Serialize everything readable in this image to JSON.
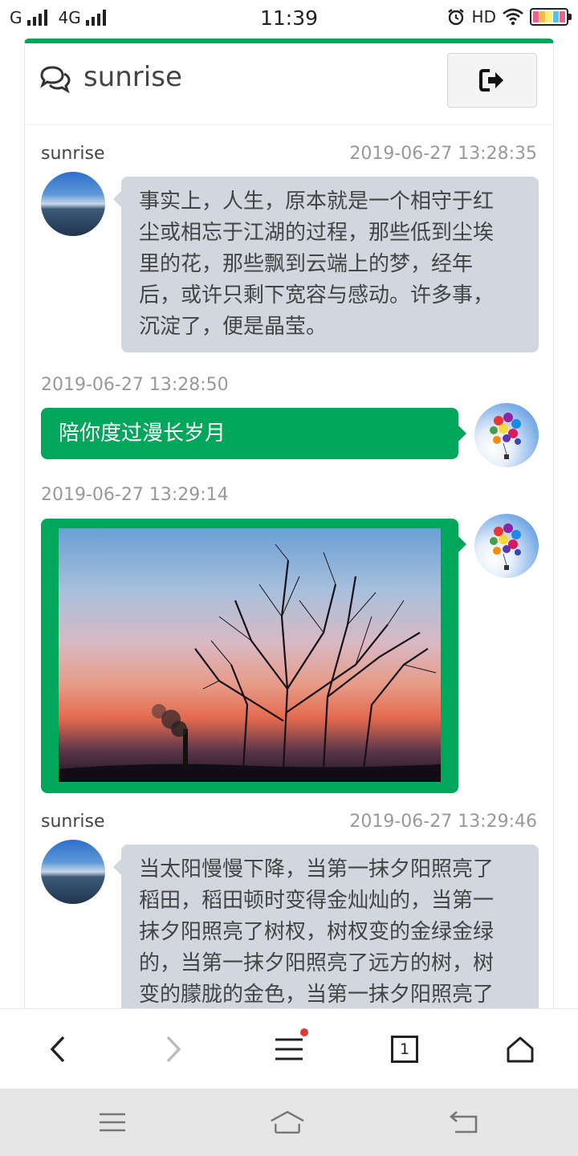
{
  "status_bar": {
    "carrier1": "G",
    "carrier2": "4G",
    "time": "11:39",
    "hd": "HD"
  },
  "header": {
    "title": "sunrise",
    "icon": "comments-icon",
    "logout_icon": "sign-out-icon"
  },
  "messages": [
    {
      "sender": "sunrise",
      "time": "2019-06-27 13:28:35",
      "lines": [
        "事实上，人生，原本就是一个相守于红",
        "尘或相忘于江湖的过程，那些低到尘埃",
        "里的花，那些飘到云端上的梦，经年",
        "后，或许只剩下宽容与感动。许多事，",
        "沉淀了，便是晶莹。"
      ]
    },
    {
      "time": "2019-06-27 13:28:50",
      "text": "陪你度过漫长岁月"
    },
    {
      "time": "2019-06-27 13:29:14",
      "image": "sunset-trees-photo"
    },
    {
      "sender": "sunrise",
      "time": "2019-06-27 13:29:46",
      "lines": [
        "当太阳慢慢下降，当第一抹夕阳照亮了",
        "稻田，稻田顿时变得金灿灿的，当第一",
        "抹夕阳照亮了树杈，树杈变的金绿金绿",
        "的，当第一抹夕阳照亮了远方的树，树",
        "变的朦胧的金色，当第一抹夕阳照亮了"
      ]
    }
  ],
  "browser_bar": {
    "back": "chevron-left-icon",
    "forward": "chevron-right-icon",
    "menu": "menu-icon",
    "tabs_count": "1",
    "home": "home-icon"
  },
  "colors": {
    "accent": "#00a65a",
    "bubble_left": "#d2d6de",
    "badge": "#e53935"
  }
}
